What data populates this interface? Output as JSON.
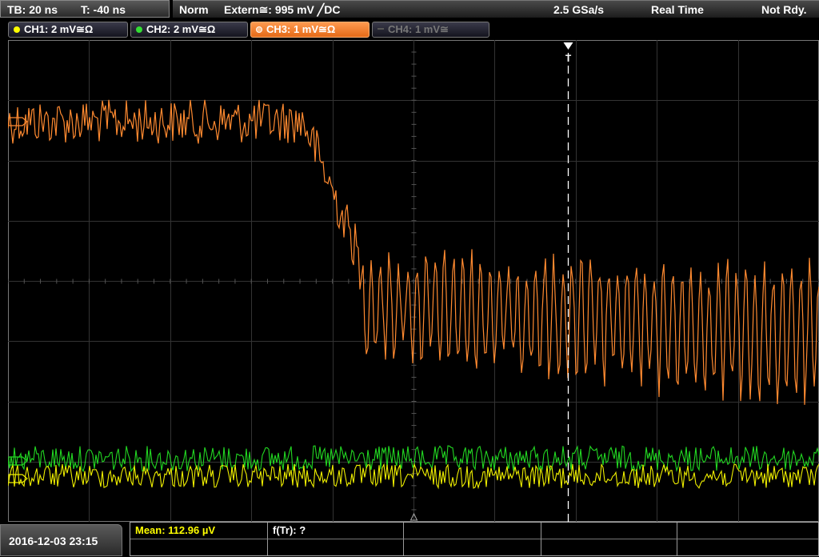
{
  "timebase": {
    "tb_label": "TB: 20 ns",
    "t_label": "T: -40 ns"
  },
  "status": {
    "mode": "Norm",
    "trigger": "Extern≅: 995 mV ╱DC",
    "sample_rate": "2.5 GSa/s",
    "acq_mode": "Real Time",
    "ready": "Not Rdy."
  },
  "channels": [
    {
      "label": "CH1: 2 mV≅Ω",
      "color": "#ffff00",
      "active": true
    },
    {
      "label": "CH2: 2 mV≅Ω",
      "color": "#33dd33",
      "active": true
    },
    {
      "label": "CH3: 1 mV≅Ω",
      "color": "#ff7f27",
      "active": true,
      "selected": true
    },
    {
      "label": "CH4: 1 mV≅",
      "color": "#777777",
      "active": false
    }
  ],
  "trigger_marker": "T",
  "footer": {
    "datetime": "2016-12-03 23:15",
    "mean_label": "Mean: 112.96 µV",
    "ftr_label": "f(Tr): ?"
  },
  "colors": {
    "ch1": "#f0f000",
    "ch2": "#22d822",
    "ch3": "#ff8a30",
    "grid": "#3a3a3a"
  }
}
